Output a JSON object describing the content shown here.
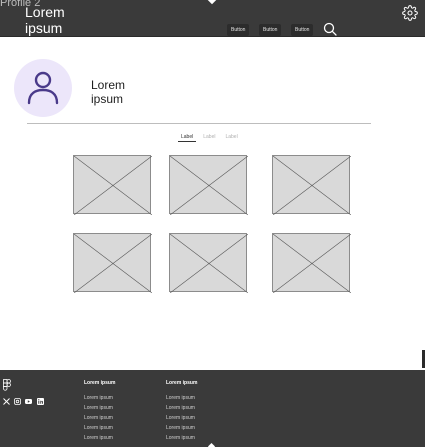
{
  "frame": {
    "label": "Profile 2"
  },
  "header": {
    "brand_line1": "Lorem",
    "brand_line2": "ipsum",
    "buttons": [
      "Button",
      "Button",
      "Button"
    ],
    "icons": {
      "search": "search-icon",
      "settings": "gear-icon"
    }
  },
  "profile": {
    "name_line1": "Lorem",
    "name_line2": "ipsum",
    "avatar_bg": "#ece6fa",
    "avatar_stroke": "#4a3a8a"
  },
  "tabs": [
    {
      "label": "Label",
      "active": true
    },
    {
      "label": "Label",
      "active": false
    },
    {
      "label": "Label",
      "active": false
    }
  ],
  "gallery": {
    "count": 6,
    "placeholder_color": "#d9d9d9"
  },
  "footer": {
    "social_icons": [
      "x-icon",
      "instagram-icon",
      "youtube-icon",
      "linkedin-icon"
    ],
    "columns": [
      {
        "title": "Lorem ipsum",
        "links": [
          "Lorem ipsum",
          "Lorem ipsum",
          "Lorem ipsum",
          "Lorem ipsum",
          "Lorem ipsum"
        ]
      },
      {
        "title": "Lorem ipsum",
        "links": [
          "Lorem ipsum",
          "Lorem ipsum",
          "Lorem ipsum",
          "Lorem ipsum",
          "Lorem ipsum"
        ]
      }
    ]
  }
}
